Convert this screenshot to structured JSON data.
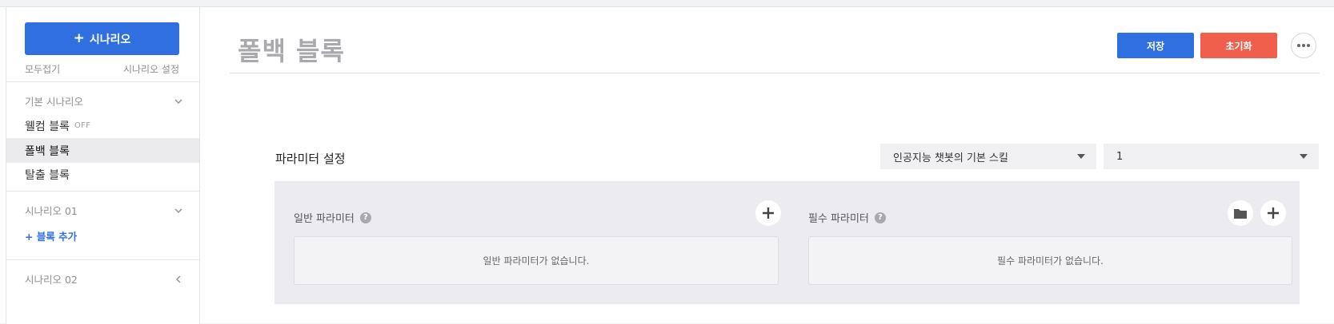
{
  "sidebar": {
    "add_button_label": "시나리오",
    "collapse_all": "모두접기",
    "scenario_settings": "시나리오 설정",
    "groups": [
      {
        "title": "기본 시나리오",
        "items": [
          {
            "label": "웰컴 블록",
            "badge": "OFF"
          },
          {
            "label": "폴백 블록",
            "active": true
          },
          {
            "label": "탈출 블록"
          }
        ]
      },
      {
        "title": "시나리오 01",
        "add_block": "+ 블록 추가"
      },
      {
        "title": "시나리오 02"
      }
    ]
  },
  "header": {
    "title": "폴백 블록",
    "save": "저장",
    "reset": "초기화"
  },
  "params": {
    "title": "파라미터 설정",
    "skill_select": "인공지능 챗봇의 기본 스킬",
    "number_select": "1",
    "general": {
      "label": "일반 파라미터",
      "empty": "일반 파라미터가 없습니다."
    },
    "required": {
      "label": "필수 파라미터",
      "empty": "필수 파라미터가 없습니다."
    },
    "help_glyph": "?"
  },
  "colors": {
    "primary": "#2f6fe0",
    "danger": "#ef5f4b",
    "panel_bg": "#ececf0"
  },
  "icons": {
    "more": "more-horizontal-icon",
    "add": "plus-icon",
    "folder": "folder-icon",
    "chevron_down": "chevron-down-icon",
    "chevron_left": "chevron-left-icon"
  }
}
